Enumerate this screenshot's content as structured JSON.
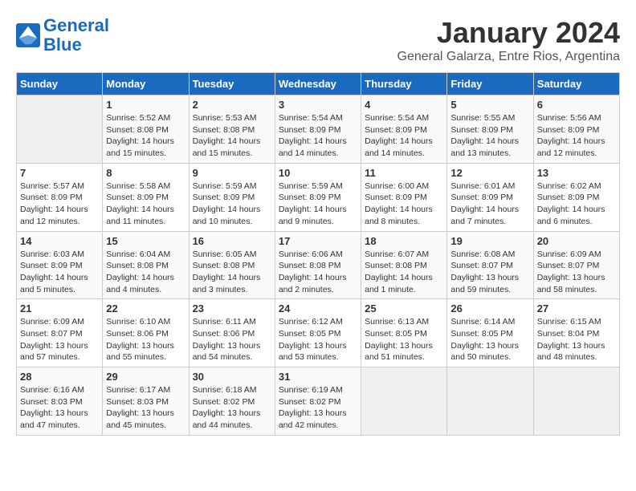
{
  "header": {
    "logo_line1": "General",
    "logo_line2": "Blue",
    "month": "January 2024",
    "location": "General Galarza, Entre Rios, Argentina"
  },
  "days_of_week": [
    "Sunday",
    "Monday",
    "Tuesday",
    "Wednesday",
    "Thursday",
    "Friday",
    "Saturday"
  ],
  "weeks": [
    [
      {
        "num": "",
        "info": ""
      },
      {
        "num": "1",
        "info": "Sunrise: 5:52 AM\nSunset: 8:08 PM\nDaylight: 14 hours\nand 15 minutes."
      },
      {
        "num": "2",
        "info": "Sunrise: 5:53 AM\nSunset: 8:08 PM\nDaylight: 14 hours\nand 15 minutes."
      },
      {
        "num": "3",
        "info": "Sunrise: 5:54 AM\nSunset: 8:09 PM\nDaylight: 14 hours\nand 14 minutes."
      },
      {
        "num": "4",
        "info": "Sunrise: 5:54 AM\nSunset: 8:09 PM\nDaylight: 14 hours\nand 14 minutes."
      },
      {
        "num": "5",
        "info": "Sunrise: 5:55 AM\nSunset: 8:09 PM\nDaylight: 14 hours\nand 13 minutes."
      },
      {
        "num": "6",
        "info": "Sunrise: 5:56 AM\nSunset: 8:09 PM\nDaylight: 14 hours\nand 12 minutes."
      }
    ],
    [
      {
        "num": "7",
        "info": "Sunrise: 5:57 AM\nSunset: 8:09 PM\nDaylight: 14 hours\nand 12 minutes."
      },
      {
        "num": "8",
        "info": "Sunrise: 5:58 AM\nSunset: 8:09 PM\nDaylight: 14 hours\nand 11 minutes."
      },
      {
        "num": "9",
        "info": "Sunrise: 5:59 AM\nSunset: 8:09 PM\nDaylight: 14 hours\nand 10 minutes."
      },
      {
        "num": "10",
        "info": "Sunrise: 5:59 AM\nSunset: 8:09 PM\nDaylight: 14 hours\nand 9 minutes."
      },
      {
        "num": "11",
        "info": "Sunrise: 6:00 AM\nSunset: 8:09 PM\nDaylight: 14 hours\nand 8 minutes."
      },
      {
        "num": "12",
        "info": "Sunrise: 6:01 AM\nSunset: 8:09 PM\nDaylight: 14 hours\nand 7 minutes."
      },
      {
        "num": "13",
        "info": "Sunrise: 6:02 AM\nSunset: 8:09 PM\nDaylight: 14 hours\nand 6 minutes."
      }
    ],
    [
      {
        "num": "14",
        "info": "Sunrise: 6:03 AM\nSunset: 8:09 PM\nDaylight: 14 hours\nand 5 minutes."
      },
      {
        "num": "15",
        "info": "Sunrise: 6:04 AM\nSunset: 8:08 PM\nDaylight: 14 hours\nand 4 minutes."
      },
      {
        "num": "16",
        "info": "Sunrise: 6:05 AM\nSunset: 8:08 PM\nDaylight: 14 hours\nand 3 minutes."
      },
      {
        "num": "17",
        "info": "Sunrise: 6:06 AM\nSunset: 8:08 PM\nDaylight: 14 hours\nand 2 minutes."
      },
      {
        "num": "18",
        "info": "Sunrise: 6:07 AM\nSunset: 8:08 PM\nDaylight: 14 hours\nand 1 minute."
      },
      {
        "num": "19",
        "info": "Sunrise: 6:08 AM\nSunset: 8:07 PM\nDaylight: 13 hours\nand 59 minutes."
      },
      {
        "num": "20",
        "info": "Sunrise: 6:09 AM\nSunset: 8:07 PM\nDaylight: 13 hours\nand 58 minutes."
      }
    ],
    [
      {
        "num": "21",
        "info": "Sunrise: 6:09 AM\nSunset: 8:07 PM\nDaylight: 13 hours\nand 57 minutes."
      },
      {
        "num": "22",
        "info": "Sunrise: 6:10 AM\nSunset: 8:06 PM\nDaylight: 13 hours\nand 55 minutes."
      },
      {
        "num": "23",
        "info": "Sunrise: 6:11 AM\nSunset: 8:06 PM\nDaylight: 13 hours\nand 54 minutes."
      },
      {
        "num": "24",
        "info": "Sunrise: 6:12 AM\nSunset: 8:05 PM\nDaylight: 13 hours\nand 53 minutes."
      },
      {
        "num": "25",
        "info": "Sunrise: 6:13 AM\nSunset: 8:05 PM\nDaylight: 13 hours\nand 51 minutes."
      },
      {
        "num": "26",
        "info": "Sunrise: 6:14 AM\nSunset: 8:05 PM\nDaylight: 13 hours\nand 50 minutes."
      },
      {
        "num": "27",
        "info": "Sunrise: 6:15 AM\nSunset: 8:04 PM\nDaylight: 13 hours\nand 48 minutes."
      }
    ],
    [
      {
        "num": "28",
        "info": "Sunrise: 6:16 AM\nSunset: 8:03 PM\nDaylight: 13 hours\nand 47 minutes."
      },
      {
        "num": "29",
        "info": "Sunrise: 6:17 AM\nSunset: 8:03 PM\nDaylight: 13 hours\nand 45 minutes."
      },
      {
        "num": "30",
        "info": "Sunrise: 6:18 AM\nSunset: 8:02 PM\nDaylight: 13 hours\nand 44 minutes."
      },
      {
        "num": "31",
        "info": "Sunrise: 6:19 AM\nSunset: 8:02 PM\nDaylight: 13 hours\nand 42 minutes."
      },
      {
        "num": "",
        "info": ""
      },
      {
        "num": "",
        "info": ""
      },
      {
        "num": "",
        "info": ""
      }
    ]
  ]
}
